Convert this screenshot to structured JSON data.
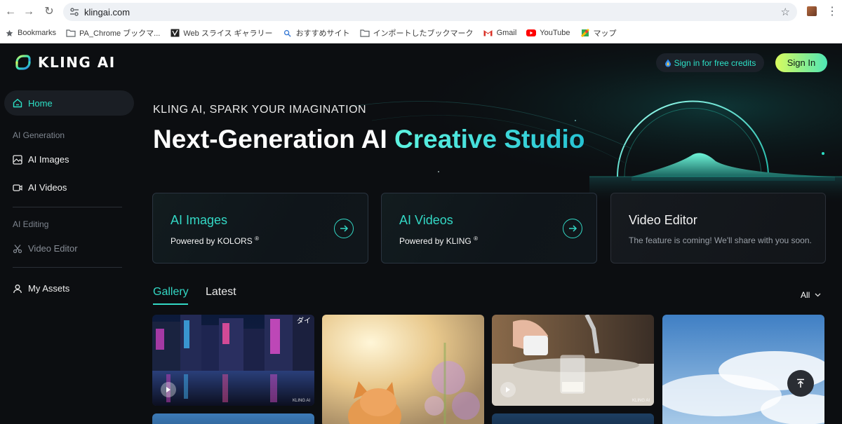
{
  "browser": {
    "url": "klingai.com",
    "bookmarks": [
      {
        "label": "Bookmarks",
        "icon": "star-icon"
      },
      {
        "label": "PA_Chrome ブックマ...",
        "icon": "folder-icon"
      },
      {
        "label": "Web スライス ギャラリー",
        "icon": "web-slice-icon"
      },
      {
        "label": "おすすめサイト",
        "icon": "search-icon"
      },
      {
        "label": "インポートしたブックマーク",
        "icon": "folder-icon"
      },
      {
        "label": "Gmail",
        "icon": "gmail-icon"
      },
      {
        "label": "YouTube",
        "icon": "youtube-icon"
      },
      {
        "label": "マップ",
        "icon": "maps-icon"
      }
    ]
  },
  "header": {
    "brand": "KLING AI",
    "free_credits": "Sign in for free credits",
    "sign_in": "Sign In"
  },
  "sidebar": {
    "home": "Home",
    "section_generation": "AI Generation",
    "ai_images": "AI Images",
    "ai_videos": "AI Videos",
    "section_editing": "AI Editing",
    "video_editor": "Video Editor",
    "my_assets": "My Assets"
  },
  "hero": {
    "tagline": "KLING AI, SPARK YOUR IMAGINATION",
    "headline_main": "Next-Generation AI ",
    "headline_accent": "Creative Studio"
  },
  "cards": [
    {
      "title": "AI Images",
      "subtitle": "Powered by KOLORS",
      "reg": "®"
    },
    {
      "title": "AI Videos",
      "subtitle": "Powered by KLING",
      "reg": "®"
    },
    {
      "title": "Video Editor",
      "subtitle": "The feature is coming! We'll share with you soon."
    }
  ],
  "gallery": {
    "tab_gallery": "Gallery",
    "tab_latest": "Latest",
    "filter": "All",
    "watermark": "KLING AI"
  },
  "colors": {
    "accent": "#33d8c5",
    "background": "#0c0e11",
    "signin_gradient_start": "#d9fb5e",
    "signin_gradient_end": "#4ee6b5"
  }
}
